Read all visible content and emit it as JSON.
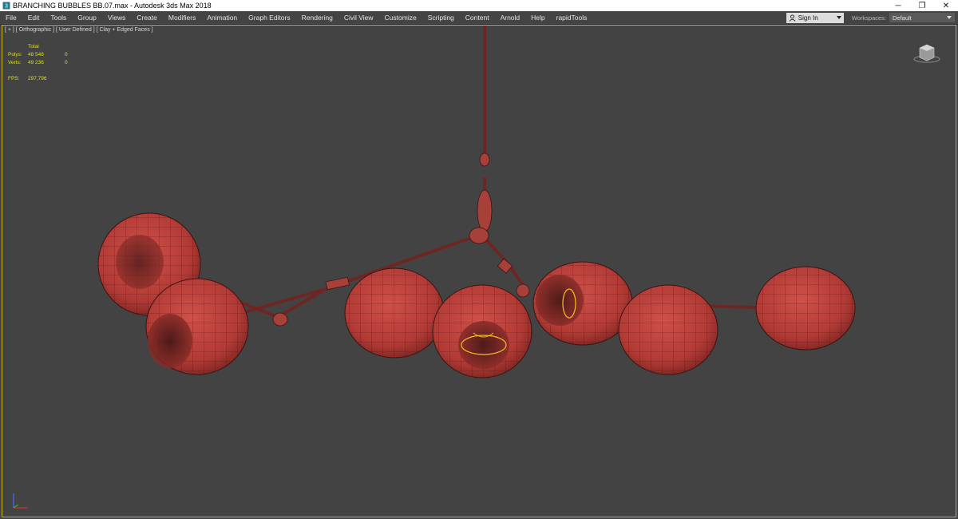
{
  "window": {
    "title": "BRANCHING BUBBLES BB.07.max - Autodesk 3ds Max 2018",
    "app_icon": "3dsmax-app-icon",
    "controls": {
      "minimize": "─",
      "restore": "❐",
      "close": "✕"
    }
  },
  "menubar": {
    "items": [
      "File",
      "Edit",
      "Tools",
      "Group",
      "Views",
      "Create",
      "Modifiers",
      "Animation",
      "Graph Editors",
      "Rendering",
      "Civil View",
      "Customize",
      "Scripting",
      "Content",
      "Arnold",
      "Help",
      "rapidTools"
    ],
    "signin_label": "Sign In",
    "workspaces_label": "Workspaces:",
    "workspaces_value": "Default"
  },
  "viewport": {
    "label": "[ + ] [ Orthographic ] [ User Defined ] [ Clay + Edged Faces ]",
    "stats": {
      "total_header": "Total",
      "polys_label": "Polys:",
      "polys_value": "48 548",
      "polys_sel": "0",
      "verts_label": "Verts:",
      "verts_value": "49 236",
      "verts_sel": "0",
      "fps_label": "FPS:",
      "fps_value": "297,796"
    },
    "border_color": "#c8b020",
    "mesh_color": "#b8403a",
    "selection_color": "#f0c020"
  }
}
